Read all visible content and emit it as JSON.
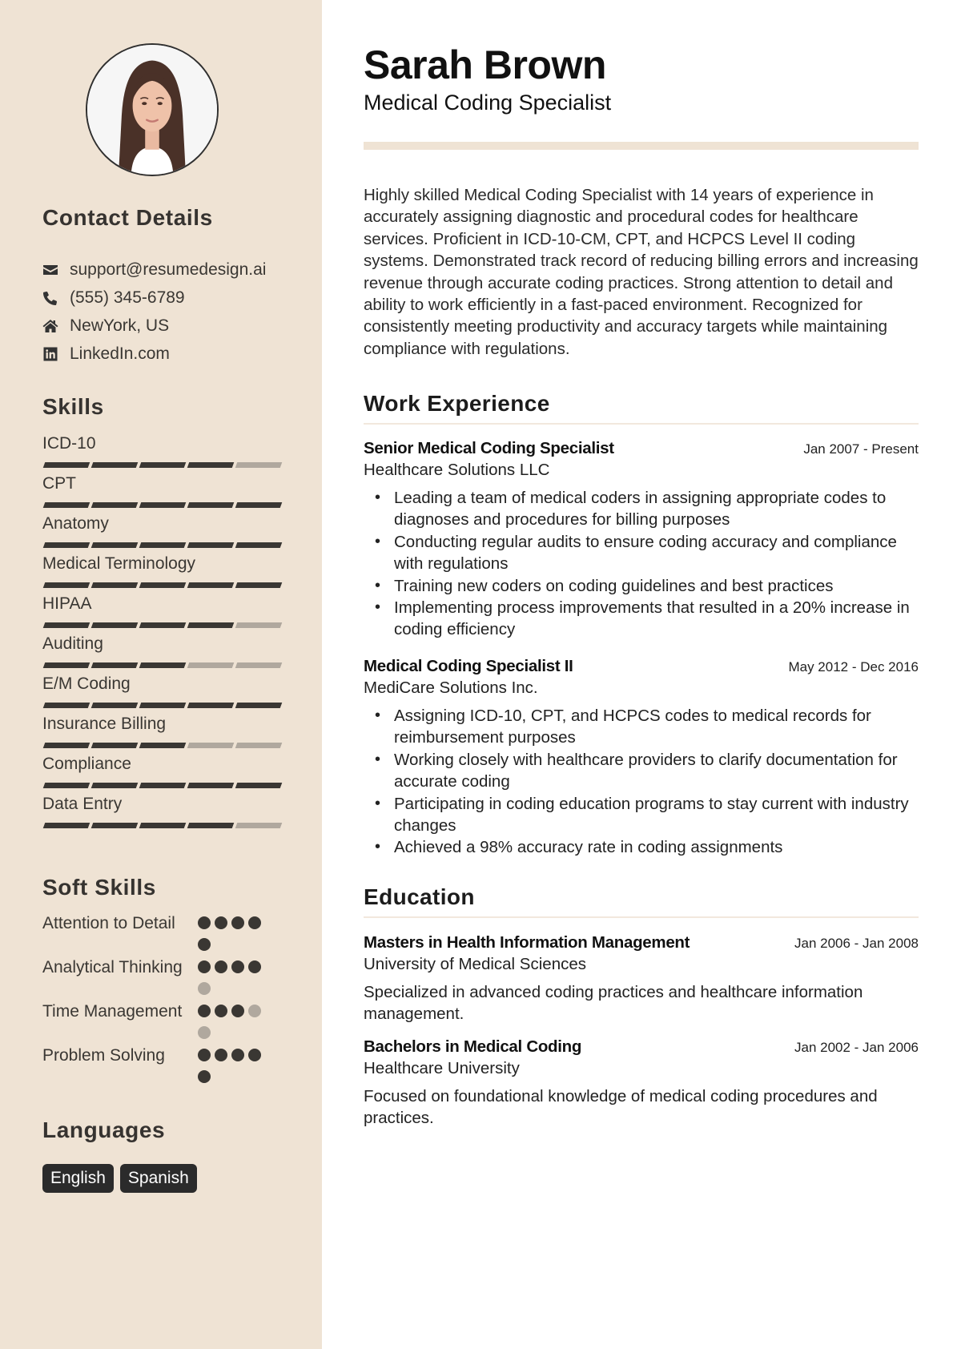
{
  "header": {
    "name": "Sarah Brown",
    "title": "Medical Coding Specialist"
  },
  "sidebar": {
    "photo_alt": "Profile photo of Sarah Brown",
    "contact": {
      "heading": "Contact Details",
      "items": [
        {
          "icon": "envelope-icon",
          "text": "support@resumedesign.ai"
        },
        {
          "icon": "phone-icon",
          "text": "(555) 345-6789"
        },
        {
          "icon": "home-icon",
          "text": "NewYork, US"
        },
        {
          "icon": "linkedin-icon",
          "text": "LinkedIn.com"
        }
      ]
    },
    "skills": {
      "heading": "Skills",
      "max_level": 5,
      "items": [
        {
          "name": "ICD-10",
          "level": 4
        },
        {
          "name": "CPT",
          "level": 5
        },
        {
          "name": "Anatomy",
          "level": 5
        },
        {
          "name": "Medical Terminology",
          "level": 5
        },
        {
          "name": "HIPAA",
          "level": 4
        },
        {
          "name": "Auditing",
          "level": 3
        },
        {
          "name": "E/M Coding",
          "level": 5
        },
        {
          "name": "Insurance Billing",
          "level": 3
        },
        {
          "name": "Compliance",
          "level": 5
        },
        {
          "name": "Data Entry",
          "level": 4
        }
      ]
    },
    "soft_skills": {
      "heading": "Soft Skills",
      "max_level": 5,
      "items": [
        {
          "name": "Attention to Detail",
          "level": 5
        },
        {
          "name": "Analytical Thinking",
          "level": 4
        },
        {
          "name": "Time Management",
          "level": 3
        },
        {
          "name": "Problem Solving",
          "level": 5
        }
      ]
    },
    "languages": {
      "heading": "Languages",
      "items": [
        "English",
        "Spanish"
      ]
    }
  },
  "summary": "Highly skilled Medical Coding Specialist with 14 years of experience in accurately assigning diagnostic and procedural codes for healthcare services. Proficient in ICD-10-CM, CPT, and HCPCS Level II coding systems. Demonstrated track record of reducing billing errors and increasing revenue through accurate coding practices. Strong attention to detail and ability to work efficiently in a fast-paced environment. Recognized for consistently meeting productivity and accuracy targets while maintaining compliance with regulations.",
  "work": {
    "heading": "Work Experience",
    "jobs": [
      {
        "title": "Senior Medical Coding Specialist",
        "company": "Healthcare Solutions LLC",
        "dates": "Jan 2007 - Present",
        "bullets": [
          "Leading a team of medical coders in assigning appropriate codes to diagnoses and procedures for billing purposes",
          "Conducting regular audits to ensure coding accuracy and compliance with regulations",
          "Training new coders on coding guidelines and best practices",
          "Implementing process improvements that resulted in a 20% increase in coding efficiency"
        ]
      },
      {
        "title": "Medical Coding Specialist II",
        "company": "MediCare Solutions Inc.",
        "dates": "May 2012 - Dec 2016",
        "bullets": [
          "Assigning ICD-10, CPT, and HCPCS codes to medical records for reimbursement purposes",
          "Working closely with healthcare providers to clarify documentation for accurate coding",
          "Participating in coding education programs to stay current with industry changes",
          "Achieved a 98% accuracy rate in coding assignments"
        ]
      }
    ]
  },
  "education": {
    "heading": "Education",
    "items": [
      {
        "degree": "Masters in Health Information Management",
        "school": "University of Medical Sciences",
        "dates": "Jan 2006 - Jan 2008",
        "description": "Specialized in advanced coding practices and healthcare information management."
      },
      {
        "degree": "Bachelors in Medical Coding",
        "school": "Healthcare University",
        "dates": "Jan 2002 - Jan 2006",
        "description": "Focused on foundational knowledge of medical coding procedures and practices."
      }
    ]
  },
  "colors": {
    "sidebar_bg": "#efe3d4",
    "bar_filled": "#3a3733",
    "bar_empty": "#b0a89e",
    "chip_bg": "#2b2b2b"
  }
}
